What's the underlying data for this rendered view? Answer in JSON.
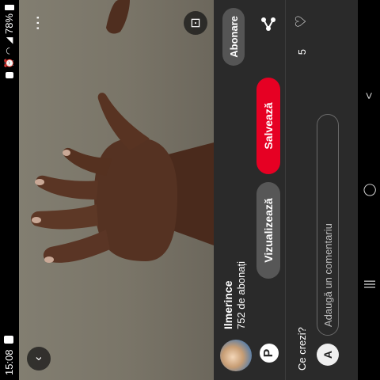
{
  "status_bar": {
    "time": "15:08",
    "battery": "78%",
    "icons": [
      "gallery-icon",
      "lock-icon",
      "alarm-icon",
      "wifi-icon",
      "signal-icon",
      "battery-icon"
    ]
  },
  "image_controls": {
    "back_icon": "chevron-left-icon",
    "menu_icon": "more-vertical-icon",
    "lens_icon": "visual-search-icon"
  },
  "creator": {
    "name": "Ilmerince",
    "subscribers": "752 de abonați",
    "subscribe_label": "Abonare"
  },
  "actions": {
    "view_label": "Vizualizează",
    "save_label": "Salvează",
    "save_color": "#e60023"
  },
  "comments": {
    "title": "Ce crezi?",
    "likes": "5",
    "input_placeholder": "Adaugă un comentariu",
    "user_initial": "A"
  },
  "nav": {
    "recent": "|||",
    "home": "◯",
    "back": "<"
  }
}
